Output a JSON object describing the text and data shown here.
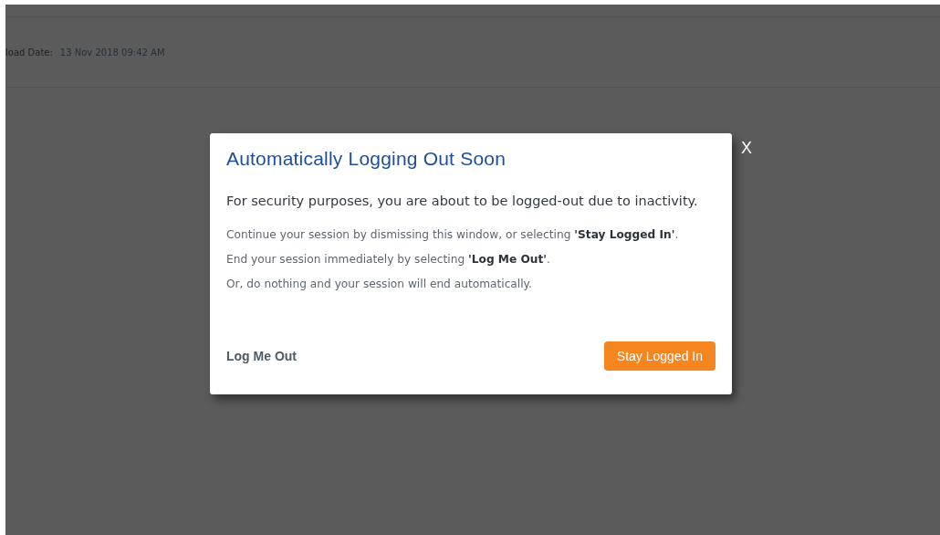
{
  "background": {
    "upload_date_label": "load Date:",
    "upload_date_value": "13 Nov 2018 09:42 AM"
  },
  "modal": {
    "title": "Automatically Logging Out Soon",
    "lead": "For security purposes, you are about to be logged-out due to inactivity.",
    "paragraphs": [
      "Continue your session by dismissing this window, or selecting **'Stay Logged In'**.",
      "End your session immediately by selecting **'Log Me Out'**.",
      "Or, do nothing and your session will end automatically."
    ],
    "secondary_button": "Log Me Out",
    "primary_button": "Stay Logged In",
    "close": "X"
  }
}
